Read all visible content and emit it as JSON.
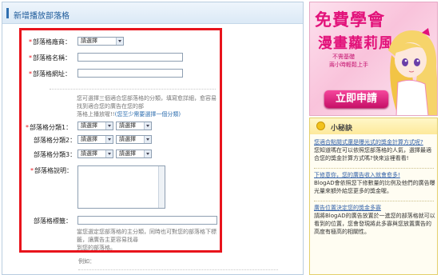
{
  "panel": {
    "title": "新增播放部落格"
  },
  "form": {
    "platform": {
      "label": "部落格廠商：",
      "value": "請選擇"
    },
    "blog_name": {
      "label": "部落格名稱：",
      "value": ""
    },
    "blog_url": {
      "label": "部落格網址：",
      "value": ""
    },
    "category_hint_line1": "您可選擇三個適合您部落格的分類，填寫愈詳細，愈容易找到適合您的廣告在您的部",
    "category_hint_line2": "落格上播放喔!!",
    "category_hint_link": "(您至少需要選擇一個分類)",
    "categories": [
      {
        "label": "部落格分類1：",
        "required": true,
        "main": "請選擇",
        "sub": "請選擇"
      },
      {
        "label": "部落格分類2：",
        "required": false,
        "main": "請選擇",
        "sub": "請選擇"
      },
      {
        "label": "部落格分類3：",
        "required": false,
        "main": "請選擇",
        "sub": "請選擇"
      }
    ],
    "description": {
      "label": "部落格說明："
    },
    "tags": {
      "label": "部落格標籤：",
      "value": ""
    },
    "tags_hint_line1": "當您選定您部落格的主分類，同時也可對您的部落格下標籤，讓廣告主更容易找尋",
    "tags_hint_line2": "到您的部落格。",
    "example_label": "例如："
  },
  "banner": {
    "line1": "免費學會",
    "line2": "漫畫蘿莉風",
    "line3": "不需基礎",
    "line4": "兩小時輕鬆上手",
    "apply_label": "立即申請"
  },
  "tips": {
    "title": "小秘訣",
    "items": [
      {
        "q": "您適合點閱式還是曝光式的獎金計算方式呢?",
        "a": "您知道嗎在可以依照您部落格的人氣，選擇最適合您的獎金計算方式嗎?快來這裡看看!"
      },
      {
        "q": "下修意你，您的廣告收入就會愈多!",
        "a": "BlogAD會依照您下修數量的比例及他們的廣告曝光量來額外給您更多的獎金喔。"
      },
      {
        "q": "廣告位置決定您的獎金多寡",
        "a": "請將BlogAD的廣告放置於一進您的部落格就可以看到的位置，您會發現將此多寡與您放置廣告的高度有極高的相關性。"
      }
    ]
  }
}
